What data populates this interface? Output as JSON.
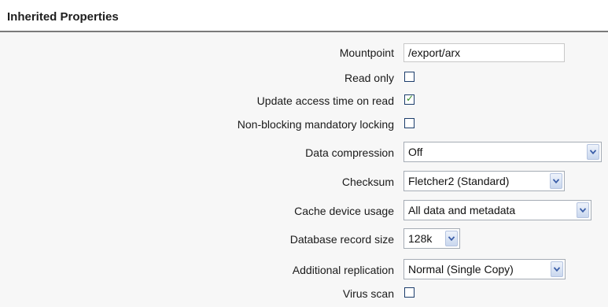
{
  "section": {
    "title": "Inherited Properties"
  },
  "fields": {
    "mountpoint": {
      "label": "Mountpoint",
      "value": "/export/arx"
    },
    "read_only": {
      "label": "Read only",
      "checked": false
    },
    "update_access_time": {
      "label": "Update access time on read",
      "checked": true,
      "check_glyph": "✓"
    },
    "non_blocking_locking": {
      "label": "Non-blocking mandatory locking",
      "checked": false
    },
    "data_compression": {
      "label": "Data compression",
      "selected": "Off"
    },
    "checksum": {
      "label": "Checksum",
      "selected": "Fletcher2 (Standard)"
    },
    "cache_device_usage": {
      "label": "Cache device usage",
      "selected": "All data and metadata"
    },
    "database_record_size": {
      "label": "Database record size",
      "selected": "128k"
    },
    "additional_replication": {
      "label": "Additional replication",
      "selected": "Normal (Single Copy)"
    },
    "virus_scan": {
      "label": "Virus scan",
      "checked": false
    }
  },
  "icons": {
    "dropdown": "chevron-down-icon",
    "check": "checkmark-icon"
  },
  "colors": {
    "header_rule": "#7a7a7a",
    "checkbox_border": "#1c3d6b",
    "checkmark": "#2f8a1e",
    "dropdown_arrow": "#3b5ea8"
  }
}
